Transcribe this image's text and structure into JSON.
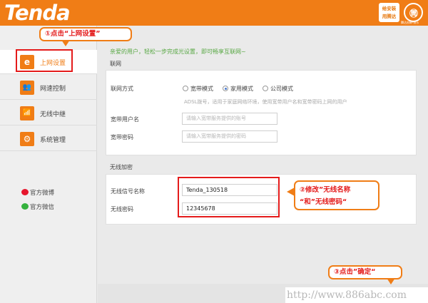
{
  "header": {
    "brand": "Tenda",
    "badge_line1": "给安装",
    "badge_line2": "用腾达",
    "bird_glyph": "㉄",
    "bird_caption": "腾达创新·快乐"
  },
  "sidebar": {
    "items": [
      {
        "label": "上网设置",
        "icon": "e",
        "active": true
      },
      {
        "label": "网速控制",
        "icon": "👥",
        "active": false
      },
      {
        "label": "无线中继",
        "icon": "📶",
        "active": false
      },
      {
        "label": "系统管理",
        "icon": "⚙",
        "active": false
      }
    ],
    "weibo": "官方微博",
    "wechat": "官方微信"
  },
  "callouts": {
    "step1": "①点击“上网设置”",
    "step2_line1": "②修改”无线名称",
    "step2_line2": "“和”无线密码“",
    "step3": "③点击”确定“"
  },
  "main": {
    "intro": "亲爱的用户，轻松一步完成光设置，即可畅享互联网~",
    "internet_section": "联网",
    "conn_mode_label": "联网方式",
    "modes": [
      "宽带模式",
      "家用模式",
      "公司模式"
    ],
    "selected_mode": "家用模式",
    "hint": "ADSL拨号，适用于家庭网络环境，使用宽带用户名和宽带密码上网的用户",
    "username_label": "宽带用户名",
    "username_placeholder": "请输入宽带服务提供的账号",
    "password_label": "宽带密码",
    "password_placeholder": "请输入宽带服务提供的密码",
    "wireless_section": "无线加密",
    "ssid_label": "无线信号名称",
    "ssid_value": "Tenda_130518",
    "wifi_pw_label": "无线密码",
    "wifi_pw_value": "12345678"
  },
  "watermark": "http://www.886abc.com",
  "colors": {
    "accent": "#f07d16",
    "highlight": "#e41b1b",
    "intro": "#58a844"
  }
}
